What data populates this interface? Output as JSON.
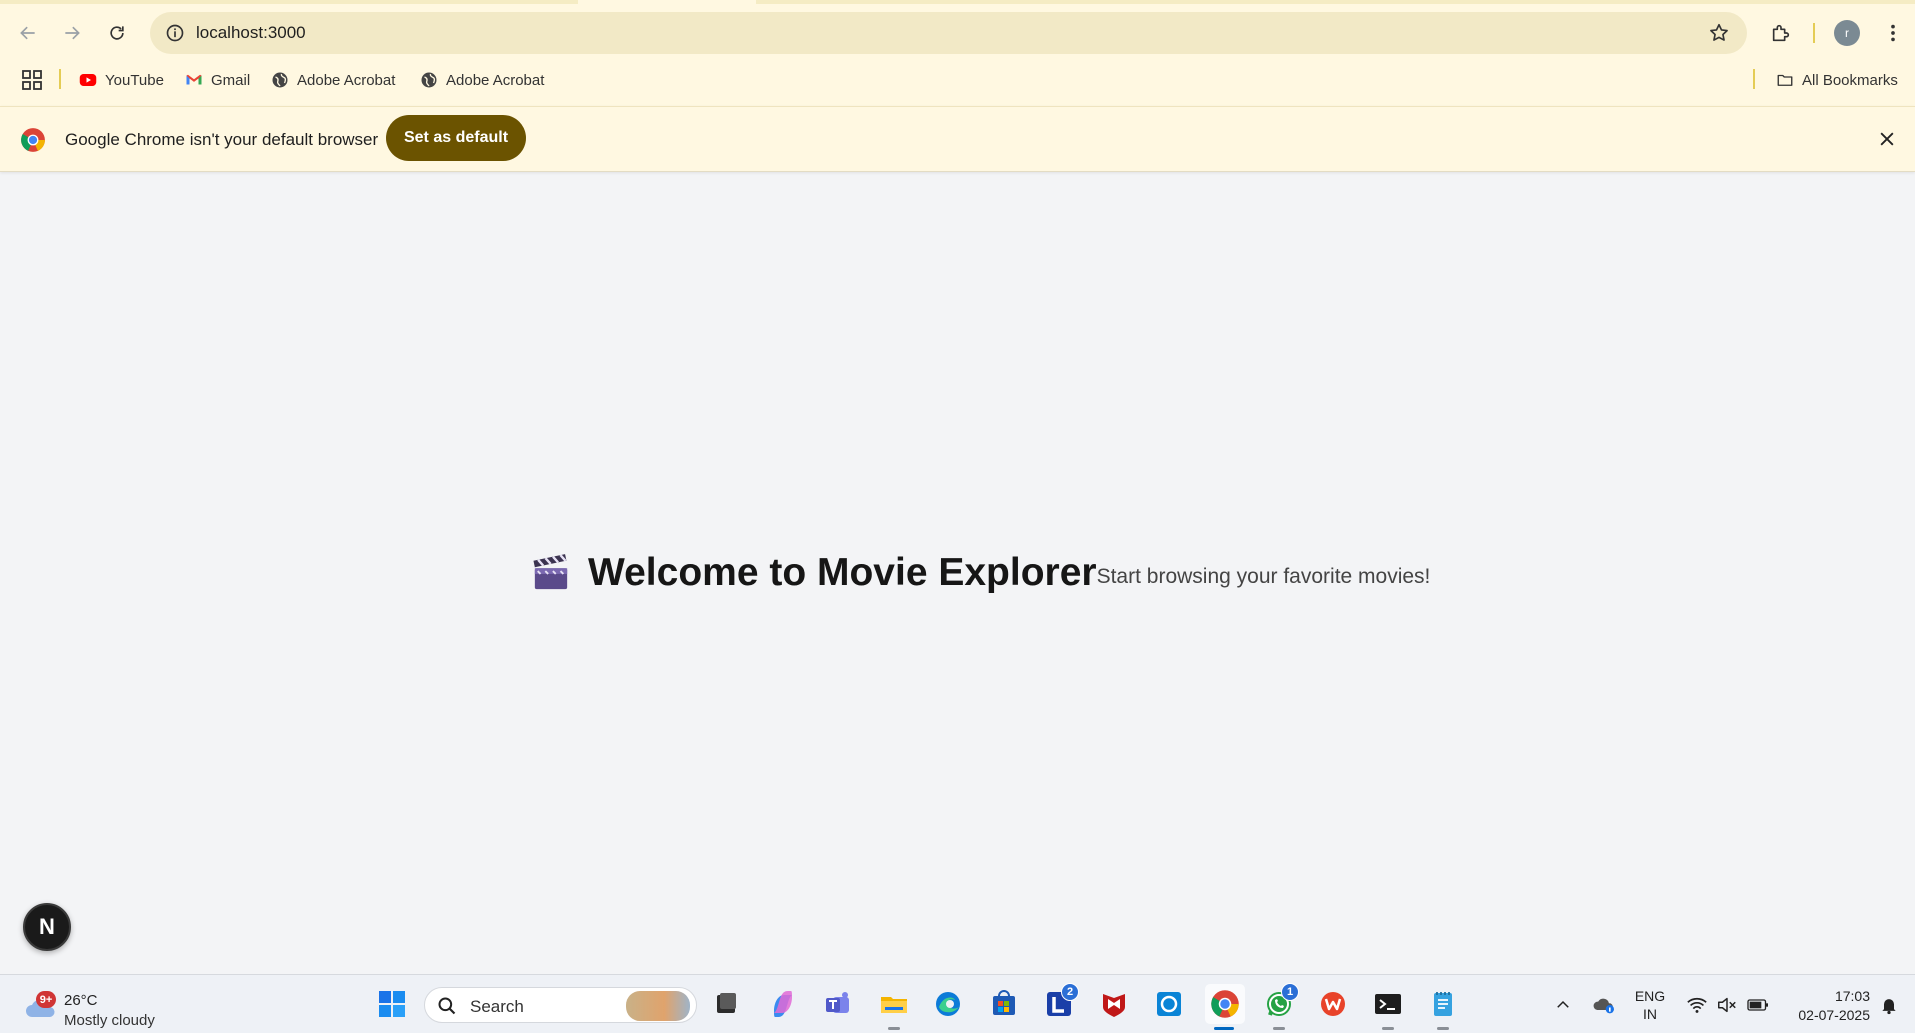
{
  "browser": {
    "url": "localhost:3000",
    "bookmarks": [
      {
        "label": "YouTube",
        "icon": "youtube-icon"
      },
      {
        "label": "Gmail",
        "icon": "gmail-icon"
      },
      {
        "label": "Adobe Acrobat",
        "icon": "globe-icon"
      },
      {
        "label": "Adobe Acrobat",
        "icon": "globe-icon"
      }
    ],
    "all_bookmarks_label": "All Bookmarks",
    "profile_initial": "r"
  },
  "infobar": {
    "message": "Google Chrome isn't your default browser",
    "button_label": "Set as default"
  },
  "page": {
    "title": "Welcome to Movie Explorer",
    "subtitle": "Start browsing your favorite movies!",
    "dev_badge": "N"
  },
  "taskbar": {
    "weather": {
      "temp": "26°C",
      "condition": "Mostly cloudy",
      "badge": "9+"
    },
    "search_label": "Search",
    "apps": [
      {
        "name": "start-icon"
      },
      {
        "name": "task-view-icon"
      },
      {
        "name": "copilot-icon"
      },
      {
        "name": "teams-icon"
      },
      {
        "name": "file-explorer-icon"
      },
      {
        "name": "edge-icon"
      },
      {
        "name": "store-icon"
      },
      {
        "name": "l-app-icon",
        "count": "2"
      },
      {
        "name": "mcafee-icon"
      },
      {
        "name": "blue-square-app-icon"
      },
      {
        "name": "chrome-icon"
      },
      {
        "name": "whatsapp-icon",
        "count": "1"
      },
      {
        "name": "wps-office-icon"
      },
      {
        "name": "terminal-icon"
      },
      {
        "name": "notepad-icon"
      }
    ],
    "language": {
      "line1": "ENG",
      "line2": "IN"
    },
    "time": "17:03",
    "date": "02-07-2025"
  },
  "colors": {
    "chrome_bg": "#fff8e1",
    "omnibox_bg": "#f2e9c6",
    "set_default_button": "#6b5300",
    "page_bg": "#f3f4f6"
  }
}
